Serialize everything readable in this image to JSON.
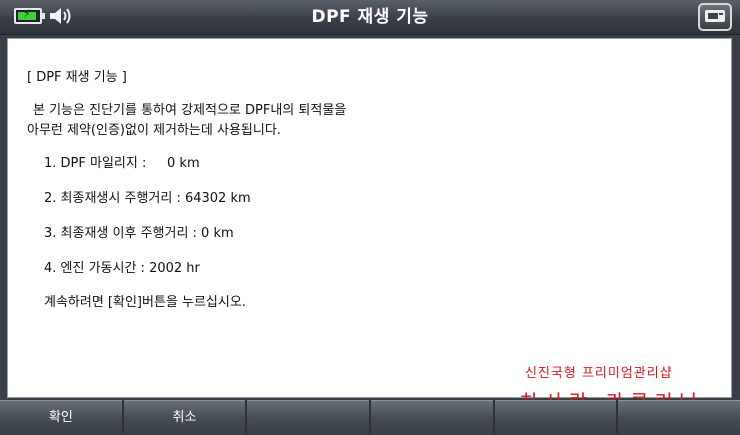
{
  "header": {
    "title": "DPF 재생 기능",
    "battery_color": "#3ed13a"
  },
  "content": {
    "heading": "[ DPF 재생 기능 ]",
    "description_line1": "본 기능은 진단기를 통하여 강제적으로 DPF내의 퇴적물을",
    "description_line2": "아무런 제약(인증)없이 제거하는데 사용됩니다.",
    "items": [
      "1. DPF 마일리지 :     0 km",
      "2. 최종재생시 주행거리 : 64302 km",
      "3. 최종재생 이후 주행거리 : 0 km",
      "4. 엔진 가동시간 : 2002 hr"
    ],
    "instruction": "계속하려면 [확인]버튼을 누르십시오."
  },
  "watermark": {
    "line1": "신진국형 프리미엄관리샵",
    "line2": "차사랑 카클리닉",
    "color": "#d81818"
  },
  "buttons": [
    "확인",
    "취소",
    "",
    "",
    "",
    ""
  ]
}
